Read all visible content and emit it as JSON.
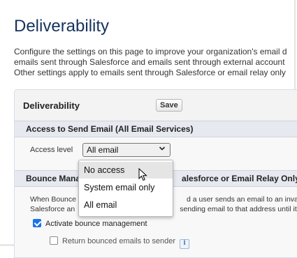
{
  "page": {
    "title": "Deliverability"
  },
  "description": {
    "line1": "Configure the settings on this page to improve your organization's email d",
    "line2": "emails sent through Salesforce and emails sent through external account",
    "line3": "Other settings apply to emails sent through Salesforce or email relay only"
  },
  "panel": {
    "title": "Deliverability",
    "save_label": "Save"
  },
  "access": {
    "section_title": "Access to Send Email (All Email Services)",
    "label": "Access level",
    "selected": "All email",
    "options": [
      "No access",
      "System email only",
      "All email"
    ]
  },
  "bounce": {
    "section_title_left": "Bounce Mana",
    "section_title_right": "alesforce or Email Relay Only)",
    "text_line1_left": "When Bounce",
    "text_line1_right": "d a user sends an email to an invali",
    "text_line2_left": "Salesforce an",
    "text_line2_right": "sending email to that address until it",
    "activate_label": "Activate bounce management",
    "activate_checked": true,
    "return_label": "Return bounced emails to sender",
    "return_checked": false
  },
  "colors": {
    "title": "#16325c",
    "checkbox_accent": "#1a73e8",
    "section_bg": "#e6e9f0"
  }
}
